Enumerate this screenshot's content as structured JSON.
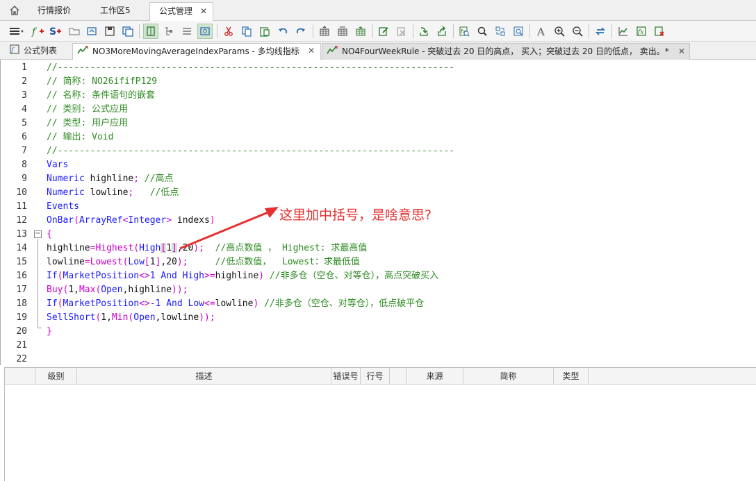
{
  "top_tabs": {
    "items": [
      {
        "label": "行情报价"
      },
      {
        "label": "工作区5"
      },
      {
        "label": "公式管理",
        "active": true
      }
    ],
    "close_symbol": "✕"
  },
  "toolbar": {
    "icons": [
      "menu-icon",
      "new-formula-icon",
      "new-signal-icon",
      "open-folder-icon",
      "open-icon",
      "save-icon",
      "save-all-icon",
      "view-mode-1-icon",
      "view-mode-2-icon",
      "view-mode-3-icon",
      "view-mode-4-icon",
      "cut-icon",
      "copy-icon",
      "paste-icon",
      "undo-icon",
      "redo-icon",
      "grid-1-icon",
      "grid-2-icon",
      "grid-3-icon",
      "edit-icon",
      "disabled-edit-icon",
      "import-icon",
      "export-icon",
      "find-in-files-icon",
      "search-icon",
      "replace-icon",
      "find-image-icon",
      "font-icon",
      "zoom-in-icon",
      "zoom-out-icon",
      "swap-icon",
      "chart-icon",
      "compile-icon",
      "delete-icon"
    ]
  },
  "file_tabs": {
    "items": [
      {
        "label": "公式列表"
      },
      {
        "label": "NO3MoreMovingAverageIndexParams - 多均线指标"
      },
      {
        "label": "NO4FourWeekRule - 突破过去 20 日的高点， 买入；突破过去 20 日的低点， 卖出。*"
      }
    ],
    "close_symbol": "✕"
  },
  "editor": {
    "line_numbers": [
      "1",
      "2",
      "3",
      "4",
      "5",
      "6",
      "7",
      "8",
      "9",
      "10",
      "11",
      "12",
      "13",
      "14",
      "15",
      "16",
      "17",
      "18",
      "19",
      "20",
      "21",
      "22"
    ],
    "lines": {
      "l1": "//-------------------------------------------------------------------------",
      "l2": "// 简称: NO26ififP129",
      "l3": "// 名称: 条件语句的嵌套",
      "l4": "// 类别: 公式应用",
      "l5": "// 类型: 用户应用",
      "l6": "// 输出: Void",
      "l7": "//-------------------------------------------------------------------------",
      "l8": "Vars",
      "l9_kw": "Numeric",
      "l9_id": " highline",
      "l9_op": ";",
      "l9_com": " //高点",
      "l10_kw": "Numeric",
      "l10_id": " lowline",
      "l10_op": ";",
      "l10_com": "   //低点",
      "l11": "Events",
      "l12_a": "OnBar",
      "l12_b": "(",
      "l12_c": "ArrayRef",
      "l12_d": "<",
      "l12_e": "Integer",
      "l12_f": ">",
      "l12_g": " indexs",
      "l12_h": ")",
      "l13": "{",
      "l14_a": "highline",
      "l14_b": "=",
      "l14_c": "Highest",
      "l14_d": "(",
      "l14_e": "High",
      "l14_f": "[",
      "l14_g": "1",
      "l14_h": "]",
      "l14_i": ",20",
      "l14_j": ");",
      "l14_com": "  //高点数值 ， Highest: 求最高值",
      "l15_a": "lowline",
      "l15_b": "=",
      "l15_c": "Lowest",
      "l15_d": "(",
      "l15_e": "Low",
      "l15_f": "[",
      "l15_g": "1",
      "l15_h": "]",
      "l15_i": ",20",
      "l15_j": ");",
      "l15_com": "     //低点数值，  Lowest：求最低值",
      "l16_a": "If",
      "l16_b": "(",
      "l16_c": "MarketPosition",
      "l16_d": "<>",
      "l16_e": "1 ",
      "l16_f": "And",
      "l16_g": " High",
      "l16_h": ">=",
      "l16_i": "highline",
      "l16_j": ")",
      "l16_com": " //非多仓（空仓、对等仓），高点突破买入",
      "l17_a": "Buy",
      "l17_b": "(",
      "l17_c": "1,",
      "l17_d": "Max",
      "l17_e": "(",
      "l17_f": "Open",
      "l17_g": ",highline",
      "l17_h": "));",
      "l18_a": "If",
      "l18_b": "(",
      "l18_c": "MarketPosition",
      "l18_d": "<>",
      "l18_e": "-1 ",
      "l18_f": "And",
      "l18_g": " Low",
      "l18_h": "<=",
      "l18_i": "lowline",
      "l18_j": ")",
      "l18_com": " //非多仓（空仓、对等仓），低点破平仓",
      "l19_a": "SellShort",
      "l19_b": "(",
      "l19_c": "1,",
      "l19_d": "Min",
      "l19_e": "(",
      "l19_f": "Open",
      "l19_g": ",lowline",
      "l19_h": "));",
      "l20": "}"
    },
    "fold_symbol": "−"
  },
  "annotation": {
    "text": "这里加中括号，是啥意思?",
    "color": "#e53030"
  },
  "grid": {
    "columns": [
      "级别",
      "描述",
      "错误号",
      "行号",
      "来源",
      "简称",
      "类型"
    ]
  }
}
